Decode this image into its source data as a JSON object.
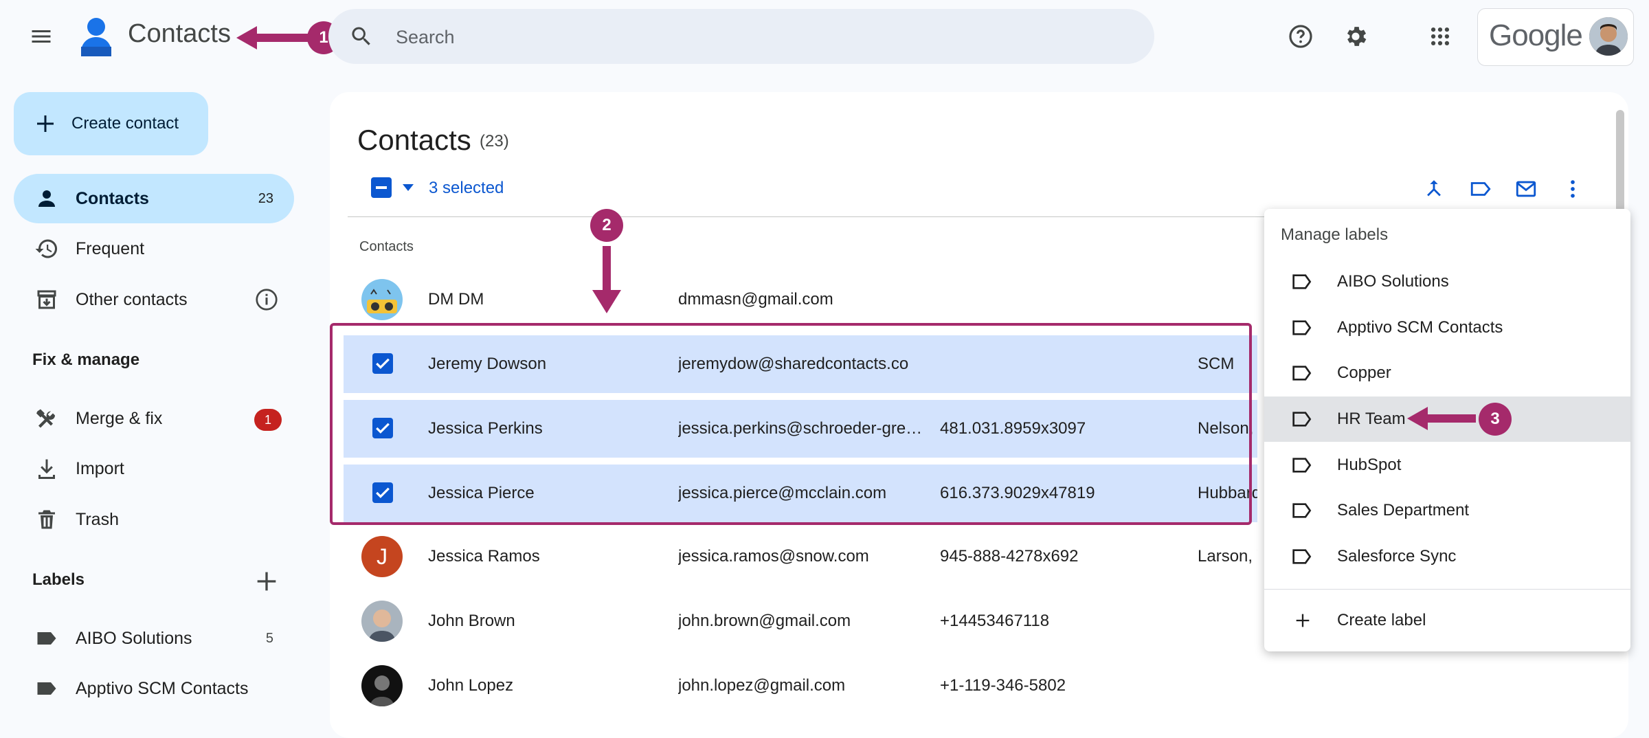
{
  "header": {
    "app_title": "Contacts",
    "search_placeholder": "Search",
    "brand": "Google"
  },
  "sidebar": {
    "create_label": "Create contact",
    "nav": [
      {
        "label": "Contacts",
        "count": "23",
        "active": true,
        "icon": "person-icon"
      },
      {
        "label": "Frequent",
        "count": "",
        "icon": "history-icon"
      },
      {
        "label": "Other contacts",
        "count": "",
        "icon": "archive-icon"
      }
    ],
    "fix_heading": "Fix & manage",
    "fix_items": [
      {
        "label": "Merge & fix",
        "badge": "1",
        "icon": "merge-tools-icon"
      },
      {
        "label": "Import",
        "icon": "download-icon"
      },
      {
        "label": "Trash",
        "icon": "trash-icon"
      }
    ],
    "labels_heading": "Labels",
    "labels": [
      {
        "label": "AIBO Solutions",
        "count": "5"
      },
      {
        "label": "Apptivo SCM Contacts",
        "count": ""
      }
    ]
  },
  "main": {
    "title": "Contacts",
    "count": "(23)",
    "selected_text": "3 selected",
    "list_heading": "Contacts",
    "rows": [
      {
        "name": "DM DM",
        "email": "dmmasn@gmail.com",
        "phone": "",
        "company": "",
        "selected": false
      },
      {
        "name": "Jeremy Dowson",
        "email": "jeremydow@sharedcontacts.co",
        "phone": "",
        "company": "SCM",
        "selected": true
      },
      {
        "name": "Jessica Perkins",
        "email": "jessica.perkins@schroeder-gree…",
        "phone": "481.031.8959x3097",
        "company": "Nelson, J",
        "selected": true
      },
      {
        "name": "Jessica Pierce",
        "email": "jessica.pierce@mcclain.com",
        "phone": "616.373.9029x47819",
        "company": "Hubbard,",
        "selected": true
      },
      {
        "name": "Jessica Ramos",
        "email": "jessica.ramos@snow.com",
        "phone": "945-888-4278x692",
        "company": "Larson, W",
        "selected": false,
        "initial": "J"
      },
      {
        "name": "John Brown",
        "email": "john.brown@gmail.com",
        "phone": "+14453467118",
        "company": "",
        "selected": false
      },
      {
        "name": "John Lopez",
        "email": "john.lopez@gmail.com",
        "phone": "+1-119-346-5802",
        "company": "",
        "selected": false
      }
    ]
  },
  "menu": {
    "title": "Manage labels",
    "items": [
      "AIBO Solutions",
      "Apptivo SCM Contacts",
      "Copper",
      "HR Team",
      "HubSpot",
      "Sales Department",
      "Salesforce Sync"
    ],
    "highlighted": "HR Team",
    "create_label": "Create label"
  },
  "callouts": [
    "1",
    "2",
    "3"
  ],
  "colors": {
    "accent": "#0b57d0",
    "selection": "#d3e3fd",
    "callout": "#a52a6b",
    "danger": "#c5221f"
  }
}
